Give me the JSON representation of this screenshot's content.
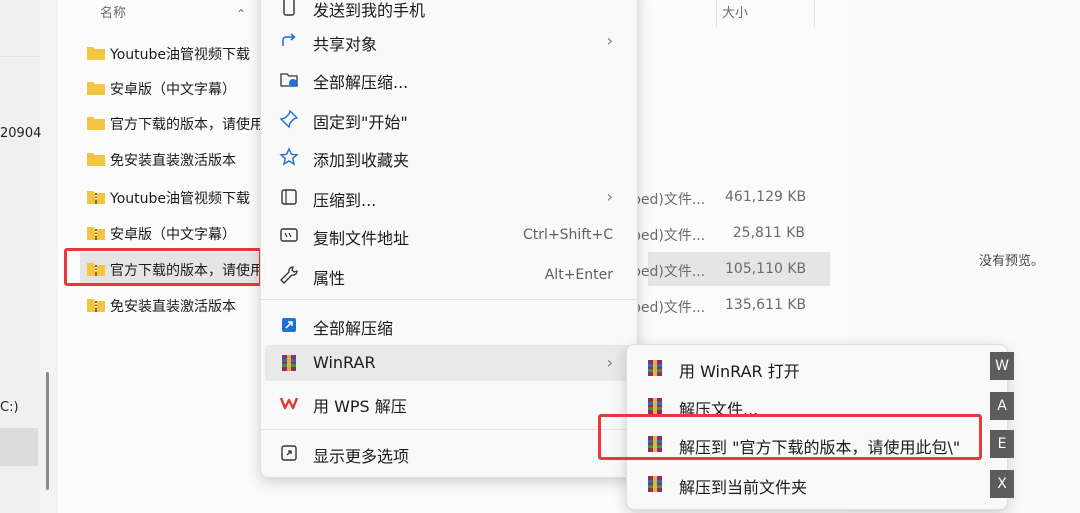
{
  "nav": {
    "frag_top": "20904",
    "frag_drive": "C:)"
  },
  "list": {
    "col_name": "名称",
    "col_size": "大小",
    "rows": [
      {
        "name": "Youtube油管视频下载",
        "type": "",
        "size": ""
      },
      {
        "name": "安卓版（中文字幕）",
        "type": "",
        "size": ""
      },
      {
        "name": "官方下载的版本，请使用此包",
        "type": "",
        "size": ""
      },
      {
        "name": "免安装直装激活版本",
        "type": "",
        "size": ""
      },
      {
        "name": "Youtube油管视频下载",
        "type": "ped)文件...",
        "size": "461,129 KB"
      },
      {
        "name": "安卓版（中文字幕）",
        "type": "ped)文件...",
        "size": "25,811 KB"
      },
      {
        "name": "官方下载的版本，请使用此包",
        "type": "ped)文件...",
        "size": "105,110 KB"
      },
      {
        "name": "免安装直装激活版本",
        "type": "ped)文件...",
        "size": "135,611 KB"
      }
    ]
  },
  "preview": {
    "message": "没有预览。"
  },
  "context_menu": {
    "items": [
      {
        "label": "发送到我的手机",
        "icon": "phone-icon"
      },
      {
        "label": "共享对象",
        "icon": "share-icon"
      },
      {
        "label": "全部解压缩...",
        "icon": "extract-all-icon"
      },
      {
        "label": "固定到\"开始\"",
        "icon": "pin-icon"
      },
      {
        "label": "添加到收藏夹",
        "icon": "star-icon"
      },
      {
        "label": "压缩到...",
        "icon": "compress-icon"
      },
      {
        "label": "复制文件地址",
        "icon": "copy-path-icon",
        "shortcut": "Ctrl+Shift+C"
      },
      {
        "label": "属性",
        "icon": "wrench-icon",
        "shortcut": "Alt+Enter"
      },
      {
        "label": "全部解压缩",
        "icon": "extract-blue-icon"
      },
      {
        "label": "WinRAR",
        "icon": "winrar-icon"
      },
      {
        "label": "用 WPS 解压",
        "icon": "wps-icon"
      },
      {
        "label": "显示更多选项",
        "icon": "more-options-icon"
      }
    ]
  },
  "winrar_submenu": {
    "items": [
      {
        "label": "用 WinRAR 打开",
        "key": "W"
      },
      {
        "label": "解压文件...",
        "key": "A"
      },
      {
        "label": "解压到 \"官方下载的版本，请使用此包\\\"",
        "key": "E"
      },
      {
        "label": "解压到当前文件夹",
        "key": "X"
      }
    ]
  },
  "colors": {
    "accent": "#0067c0",
    "highlight_red": "#e23b3b",
    "folder_yellow": "#f4c542"
  }
}
